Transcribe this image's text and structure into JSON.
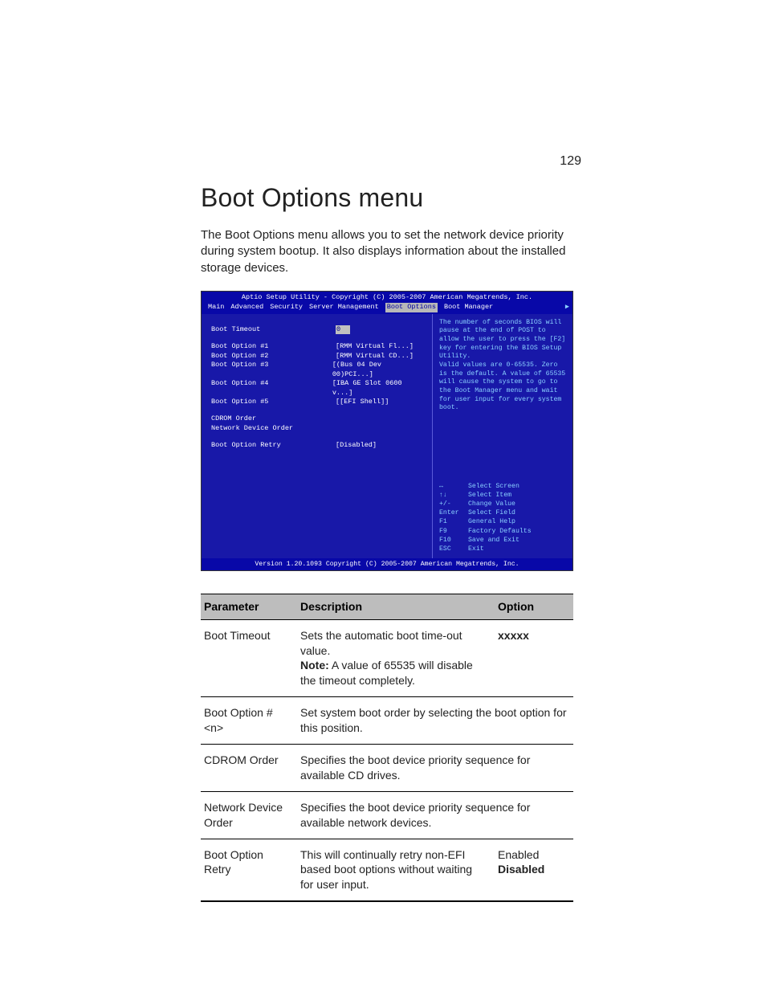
{
  "page_number": "129",
  "title": "Boot Options menu",
  "intro": "The Boot Options menu allows you to set the network device priority during system bootup. It also displays information about the installed storage devices.",
  "bios": {
    "header": "Aptio Setup Utility - Copyright (C) 2005-2007 American Megatrends, Inc.",
    "menubar": {
      "items": [
        "Main",
        "Advanced",
        "Security",
        "Server Management",
        "Boot Options",
        "Boot Manager"
      ],
      "selected_index": 4,
      "arrow": "▶"
    },
    "left": {
      "timeout_label": "Boot Timeout",
      "timeout_value": "0",
      "options": [
        {
          "label": "Boot Option #1",
          "value": "[RMM    Virtual Fl...]"
        },
        {
          "label": "Boot Option #2",
          "value": "[RMM    Virtual CD...]"
        },
        {
          "label": "Boot Option #3",
          "value": "[(Bus 04 Dev 00)PCI...]"
        },
        {
          "label": "Boot Option #4",
          "value": "[IBA GE Slot 0600 v...]"
        },
        {
          "label": "Boot Option #5",
          "value": "[[EFI Shell]]"
        }
      ],
      "cdrom_label": "CDROM Order",
      "netdev_label": "Network Device Order",
      "retry_label": "Boot Option Retry",
      "retry_value": "[Disabled]"
    },
    "help_text": "The number of seconds BIOS will pause at the end of POST to allow the user to press the [F2] key for entering the BIOS Setup Utility.\nValid values are 0-65535. Zero is the default. A value of 65535 will cause the system to go to the Boot Manager menu and wait for user input for every system boot.",
    "keys": [
      {
        "k": "↔",
        "d": "Select Screen"
      },
      {
        "k": "↑↓",
        "d": "Select Item"
      },
      {
        "k": "+/-",
        "d": "Change Value"
      },
      {
        "k": "Enter",
        "d": "Select Field"
      },
      {
        "k": "F1",
        "d": "General Help"
      },
      {
        "k": "F9",
        "d": "Factory Defaults"
      },
      {
        "k": "F10",
        "d": "Save and Exit"
      },
      {
        "k": "ESC",
        "d": "Exit"
      }
    ],
    "footer": "Version 1.20.1093 Copyright (C) 2005-2007 American Megatrends, Inc."
  },
  "table": {
    "headers": {
      "param": "Parameter",
      "desc": "Description",
      "opt": "Option"
    },
    "rows": [
      {
        "param": "Boot Timeout",
        "desc_pre": "Sets the automatic boot time-out value.",
        "note_label": "Note:",
        "note_text": " A value of 65535 will disable the timeout completely.",
        "opt": "xxxxx",
        "opt_bold": true
      },
      {
        "param": "Boot Option #<n>",
        "desc_full": "Set system boot order by selecting the boot option for this position.",
        "span": true
      },
      {
        "param": "CDROM Order",
        "desc_full": "Specifies the boot device priority sequence for available CD drives.",
        "span": true
      },
      {
        "param": "Network Device Order",
        "desc_full": "Specifies the boot device priority sequence for available network devices.",
        "span": true
      },
      {
        "param": "Boot Option Retry",
        "desc_full": "This will continually retry non-EFI based boot options without waiting for user input.",
        "opt_lines": [
          "Enabled",
          "Disabled"
        ],
        "opt_bold_index": 1
      }
    ]
  }
}
